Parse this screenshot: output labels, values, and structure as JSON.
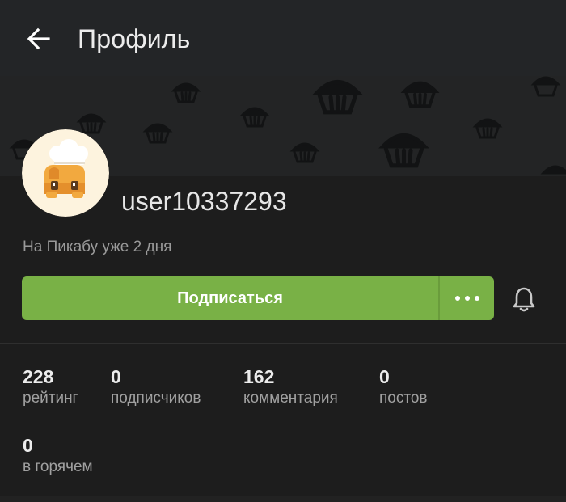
{
  "appbar": {
    "back_icon": "arrow-left-icon",
    "title": "Профиль"
  },
  "profile": {
    "avatar_icon": "chef-pikabu-avatar",
    "username": "user10337293",
    "since": "На Пикабу уже 2 дня"
  },
  "actions": {
    "subscribe_label": "Подписаться",
    "more_icon": "more-dots-icon",
    "bell_icon": "bell-icon"
  },
  "stats": [
    {
      "value": "228",
      "label": "рейтинг"
    },
    {
      "value": "0",
      "label": "подписчиков"
    },
    {
      "value": "162",
      "label": "комментария"
    },
    {
      "value": "0",
      "label": "постов"
    },
    {
      "value": "0",
      "label": "в горячем"
    }
  ],
  "colors": {
    "background": "#1d1d1d",
    "appbar": "#232527",
    "accent_green": "#79b146",
    "muted_text": "#9a9a9a"
  }
}
